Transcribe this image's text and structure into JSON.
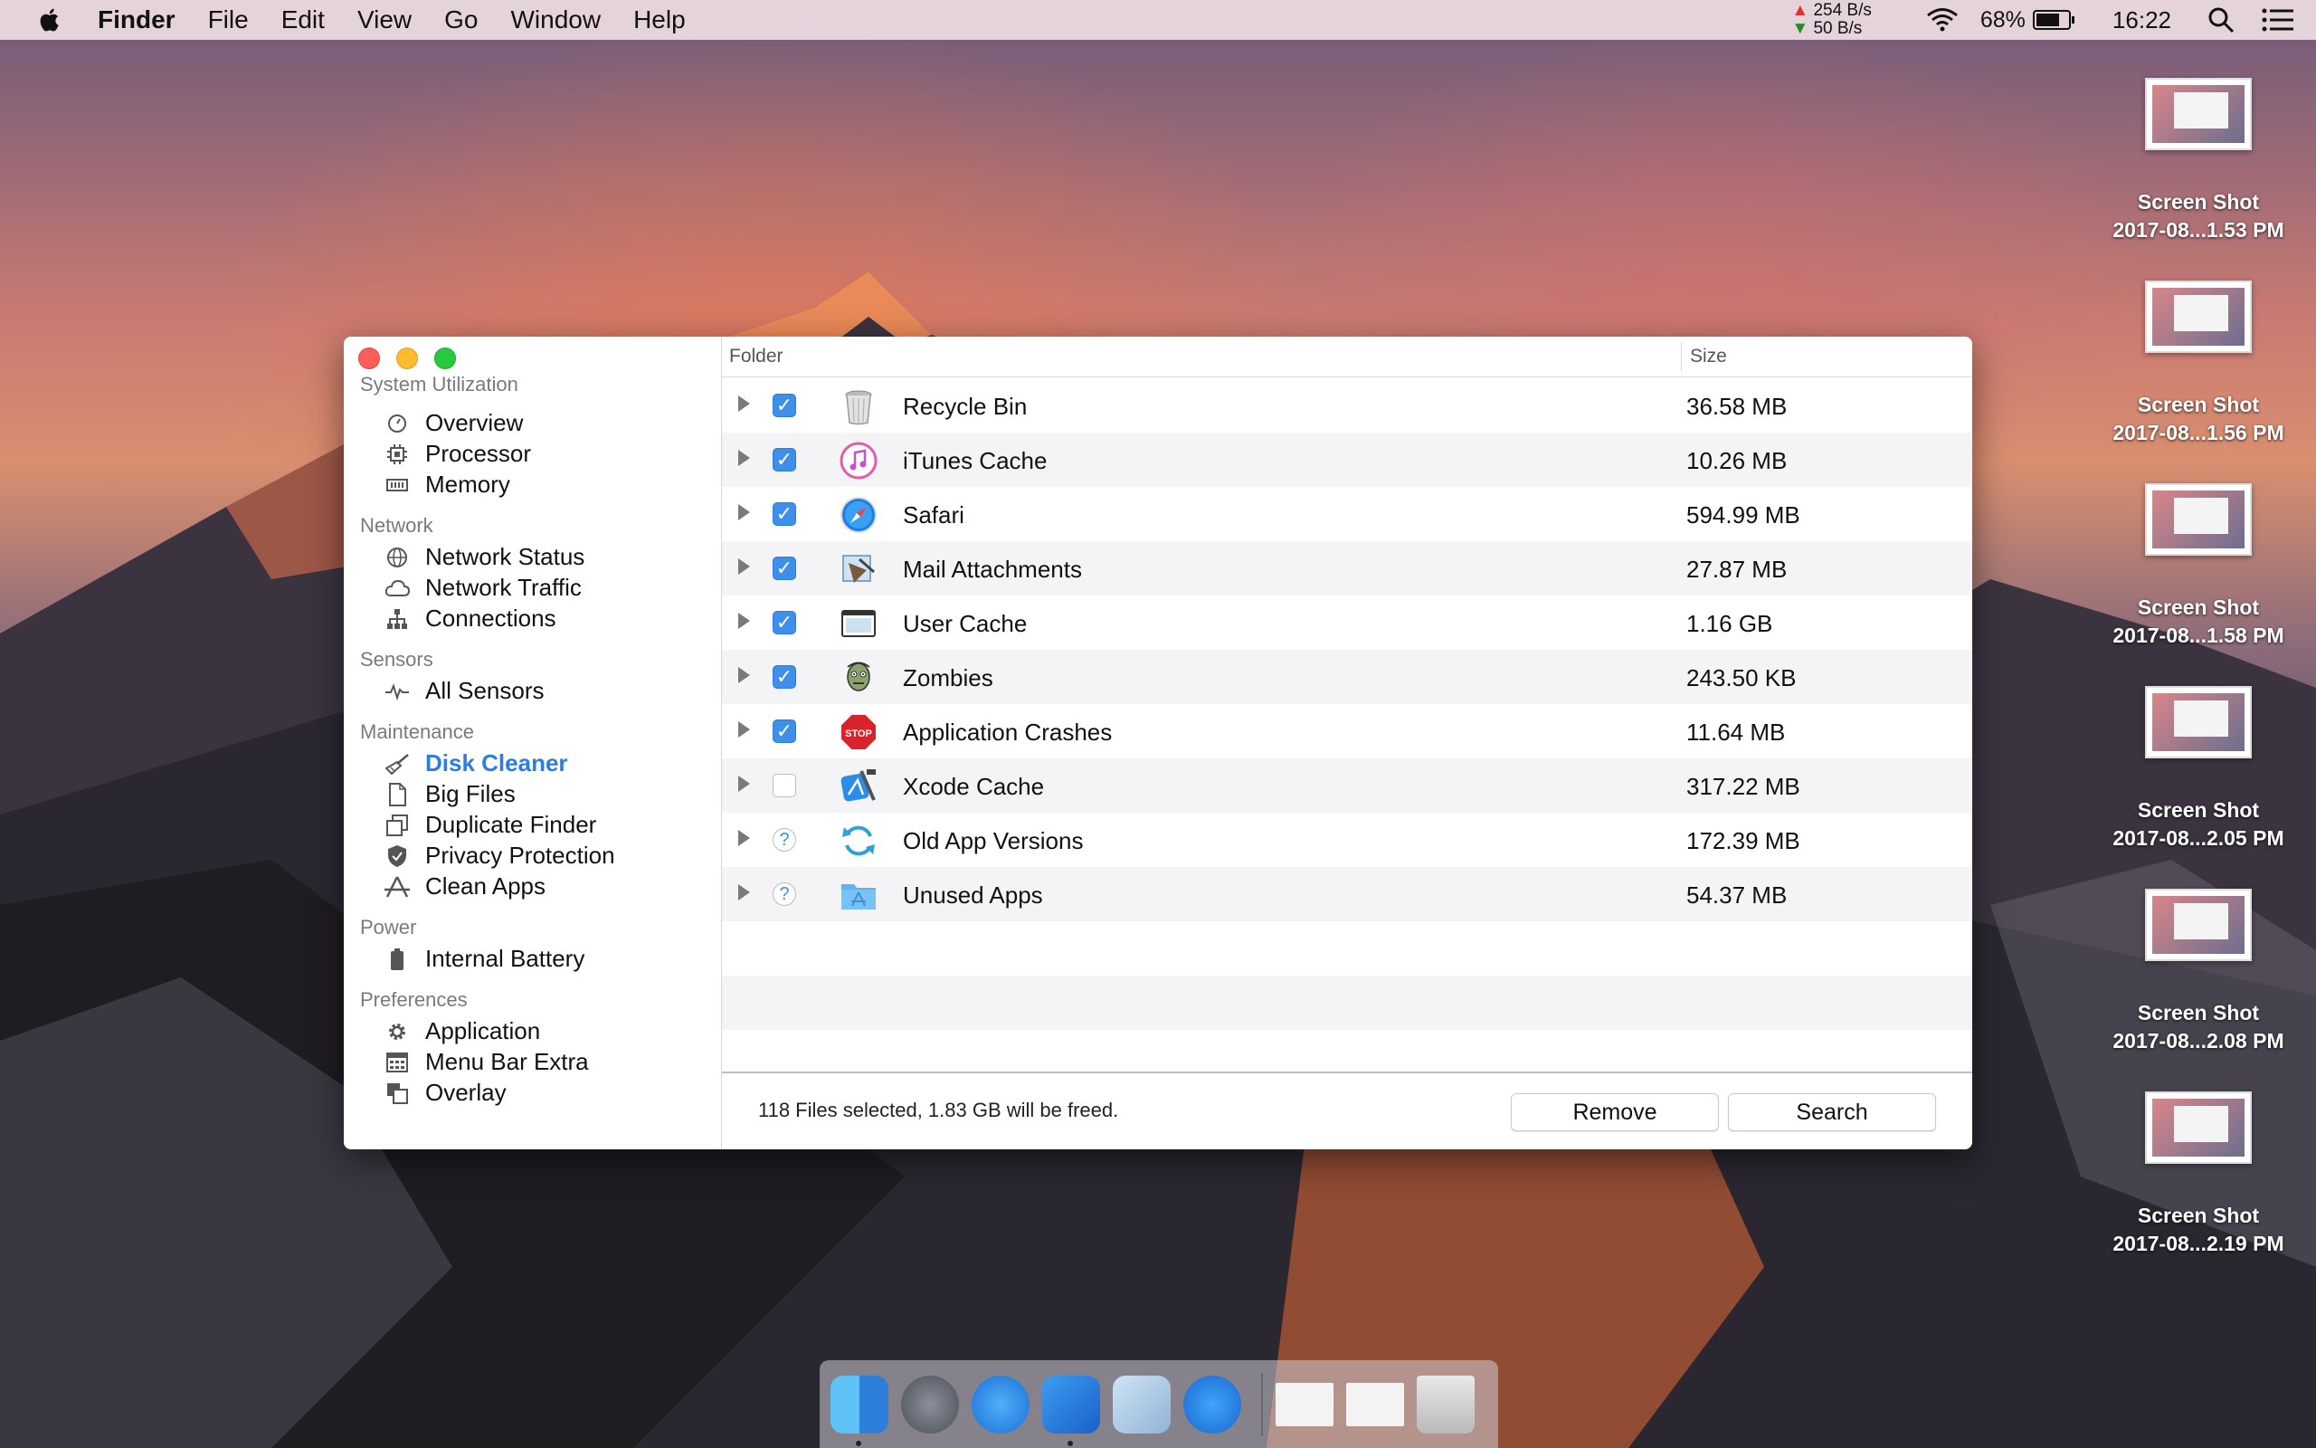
{
  "menubar": {
    "app_name": "Finder",
    "menus": [
      "File",
      "Edit",
      "View",
      "Go",
      "Window",
      "Help"
    ],
    "net_up": "254 B/s",
    "net_down": "50 B/s",
    "battery": "68%",
    "time": "16:22"
  },
  "desktop": [
    {
      "line1": "Screen Shot",
      "line2": "2017-08...1.53 PM"
    },
    {
      "line1": "Screen Shot",
      "line2": "2017-08...1.56 PM"
    },
    {
      "line1": "Screen Shot",
      "line2": "2017-08...1.58 PM"
    },
    {
      "line1": "Screen Shot",
      "line2": "2017-08...2.05 PM"
    },
    {
      "line1": "Screen Shot",
      "line2": "2017-08...2.08 PM"
    },
    {
      "line1": "Screen Shot",
      "line2": "2017-08...2.19 PM"
    }
  ],
  "sidebar": {
    "sections": [
      {
        "title": "System Utilization",
        "items": [
          "Overview",
          "Processor",
          "Memory"
        ]
      },
      {
        "title": "Network",
        "items": [
          "Network Status",
          "Network Traffic",
          "Connections"
        ]
      },
      {
        "title": "Sensors",
        "items": [
          "All Sensors"
        ]
      },
      {
        "title": "Maintenance",
        "items": [
          "Disk Cleaner",
          "Big Files",
          "Duplicate Finder",
          "Privacy Protection",
          "Clean Apps"
        ]
      },
      {
        "title": "Power",
        "items": [
          "Internal Battery"
        ]
      },
      {
        "title": "Preferences",
        "items": [
          "Application",
          "Menu Bar Extra",
          "Overlay"
        ]
      }
    ],
    "active": "Disk Cleaner"
  },
  "table": {
    "col_folder": "Folder",
    "col_size": "Size",
    "rows": [
      {
        "name": "Recycle Bin",
        "size": "36.58 MB",
        "check": "on"
      },
      {
        "name": "iTunes Cache",
        "size": "10.26 MB",
        "check": "on"
      },
      {
        "name": "Safari",
        "size": "594.99 MB",
        "check": "on"
      },
      {
        "name": "Mail Attachments",
        "size": "27.87 MB",
        "check": "on"
      },
      {
        "name": "User Cache",
        "size": "1.16 GB",
        "check": "on"
      },
      {
        "name": "Zombies",
        "size": "243.50 KB",
        "check": "on"
      },
      {
        "name": "Application Crashes",
        "size": "11.64 MB",
        "check": "on"
      },
      {
        "name": "Xcode Cache",
        "size": "317.22 MB",
        "check": "off"
      },
      {
        "name": "Old App Versions",
        "size": "172.39 MB",
        "check": "question"
      },
      {
        "name": "Unused Apps",
        "size": "54.37 MB",
        "check": "question"
      }
    ],
    "stop_label": "STOP",
    "question_mark": "?"
  },
  "footer": {
    "status": "118 Files selected, 1.83 GB will be freed.",
    "remove_label": "Remove",
    "search_label": "Search"
  },
  "colors": {
    "accent": "#2a7de1",
    "checkbox": "#3d8fea"
  }
}
